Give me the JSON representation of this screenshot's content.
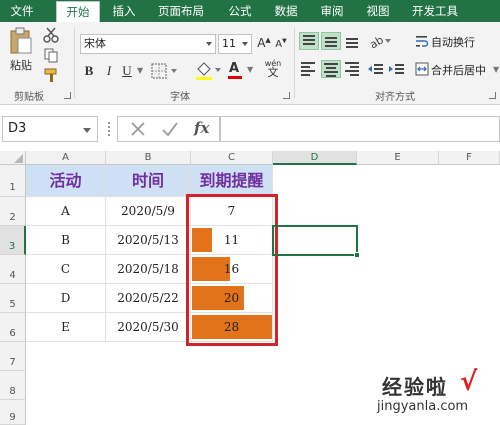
{
  "ribbon_tabs": [
    "文件",
    "开始",
    "插入",
    "页面布局",
    "公式",
    "数据",
    "审阅",
    "视图",
    "开发工具"
  ],
  "active_tab": "开始",
  "accent_color": "#217346",
  "clipboard": {
    "paste_label": "粘贴",
    "group_label": "剪贴板"
  },
  "font": {
    "name": "宋体",
    "size": "11",
    "bold": "B",
    "italic": "I",
    "underline": "U",
    "font_color_glyph": "A",
    "wen_glyph": "wén",
    "group_label": "字体"
  },
  "alignment": {
    "wrap_text_label": "自动换行",
    "merge_center_label": "合并后居中",
    "group_label": "对齐方式"
  },
  "formula_bar": {
    "name_box": "D3",
    "fx_label": "fx",
    "formula": ""
  },
  "columns": [
    "A",
    "B",
    "C",
    "D",
    "E",
    "F"
  ],
  "selected_column": "D",
  "rows": [
    "1",
    "2",
    "3",
    "4",
    "5",
    "6",
    "7",
    "8",
    "9"
  ],
  "selected_row": "3",
  "table": {
    "headers": [
      "活动",
      "时间",
      "到期提醒"
    ],
    "records": [
      {
        "activity": "A",
        "date": "2020/5/9",
        "days": "7"
      },
      {
        "activity": "B",
        "date": "2020/5/13",
        "days": "11"
      },
      {
        "activity": "C",
        "date": "2020/5/18",
        "days": "16"
      },
      {
        "activity": "D",
        "date": "2020/5/22",
        "days": "20"
      },
      {
        "activity": "E",
        "date": "2020/5/30",
        "days": "28"
      }
    ]
  },
  "data_bar": {
    "color": "#e3731a",
    "min": 7,
    "max": 28,
    "values": [
      7,
      11,
      16,
      20,
      28
    ]
  },
  "highlight_color": "#d2232a",
  "header_fill": "#cfe0f4",
  "header_text_color": "#7030a0",
  "watermark": {
    "main": "经验啦",
    "sub": "jingyanla.com",
    "check": "√"
  }
}
